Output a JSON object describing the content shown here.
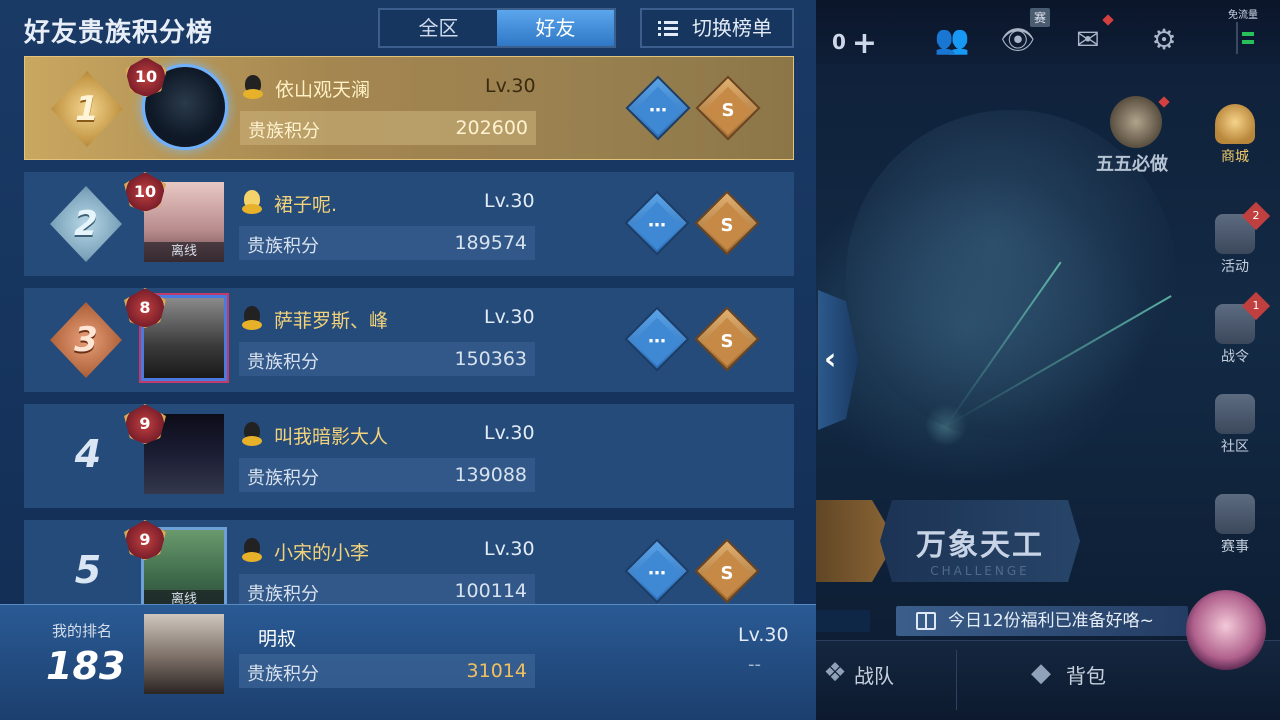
{
  "panel": {
    "title": "好友贵族积分榜",
    "tabs": [
      {
        "label": "全区",
        "active": false
      },
      {
        "label": "好友",
        "active": true
      }
    ],
    "switch_label": "切换榜单"
  },
  "score_label": "贵族积分",
  "offline_label": "离线",
  "rows": [
    {
      "rank": "1",
      "noble": "10",
      "name": "依山观天澜",
      "level": "Lv.30",
      "score": "202600",
      "online": true,
      "actions": true
    },
    {
      "rank": "2",
      "noble": "10",
      "name": "裙子呢.",
      "level": "Lv.30",
      "score": "189574",
      "online": false,
      "actions": true
    },
    {
      "rank": "3",
      "noble": "8",
      "name": "萨菲罗斯、峰",
      "level": "Lv.30",
      "score": "150363",
      "online": true,
      "actions": true
    },
    {
      "rank": "4",
      "noble": "9",
      "name": "叫我暗影大人",
      "level": "Lv.30",
      "score": "139088",
      "online": true,
      "actions": false
    },
    {
      "rank": "5",
      "noble": "9",
      "name": "小宋的小李",
      "level": "Lv.30",
      "score": "100114",
      "online": false,
      "actions": true
    }
  ],
  "me": {
    "label": "我的排名",
    "rank": "183",
    "name": "明叔",
    "score": "31014",
    "level": "Lv.30",
    "dash": "--"
  },
  "topbar": {
    "coin_value": "0",
    "sai_badge": "赛",
    "net_label": "免流量"
  },
  "side_menu": {
    "wuwu": "五五必做",
    "shop": "商城",
    "activity": "活动",
    "activity_badge": "2",
    "battlepass": "战令",
    "battlepass_badge": "1",
    "community": "社区",
    "events": "赛事"
  },
  "challenge": {
    "title": "万象天工",
    "subtitle": "CHALLENGE"
  },
  "gift_banner": "今日12份福利已准备好咯~",
  "bottom_nav": {
    "team": "战队",
    "bag": "背包"
  },
  "colors": {
    "accent": "#2f78c6",
    "gold": "#f0c060",
    "alert": "#d44040"
  }
}
